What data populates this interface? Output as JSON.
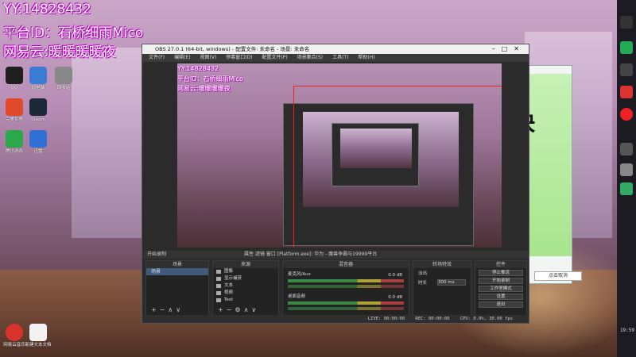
{
  "overlay": {
    "line1": "YY:14828432",
    "line2": "平台ID：石桥细雨Mico",
    "line3": "网易云:暖暖暖暖夜"
  },
  "desktop_icons": [
    {
      "label": "QQ",
      "color": "#1f1f1f"
    },
    {
      "label": "此电脑",
      "color": "#3a7bd5"
    },
    {
      "label": "回收站",
      "color": "#888888"
    },
    {
      "label": "完美世界",
      "color": "#e04a2a"
    },
    {
      "label": "Steam",
      "color": "#1b2838"
    },
    {
      "label": "腾讯游戏",
      "color": "#2aa84a"
    },
    {
      "label": "迅雷",
      "color": "#2f6fd6"
    },
    {
      "label": "网易云音乐",
      "color": "#d8322c"
    },
    {
      "label": "新建文本文档",
      "color": "#f2f2f2"
    }
  ],
  "phone": {
    "big1": "畅快",
    "big2": "(((",
    "button": "点击取消"
  },
  "obs": {
    "title": "OBS 27.0.1 (64-bit, windows) - 配置文件: 未命名 - 场景: 未命名",
    "menu": [
      "文件(F)",
      "编辑(E)",
      "视图(V)",
      "停靠窗口(D)",
      "配置文件(P)",
      "场景集合(S)",
      "工具(T)",
      "帮助(H)"
    ],
    "preview_overlay": {
      "line1": "YY:14828432",
      "line2": "平台ID：石桥细雨Mico",
      "line3": "网易云:暖暖暖暖夜"
    },
    "dock_bar_left": "开始录制",
    "dock_bar_mid": "属性  滤镜  窗口 [Platform.exe]: 华为 - 魔兽争霸与19999平台",
    "docks": {
      "scenes": {
        "title": "场景",
        "items": [
          "场景"
        ]
      },
      "sources": {
        "title": "来源",
        "items": [
          "图像",
          "显示捕获",
          "文本",
          "视频",
          "Text"
        ]
      },
      "mixer": {
        "title": "混音器",
        "tracks": [
          {
            "name": "麦克风/Aux",
            "value": "0.0 dB"
          },
          {
            "name": "桌面音频",
            "value": "0.0 dB"
          }
        ]
      },
      "transitions": {
        "title": "转场特效",
        "type": "淡出",
        "duration_label": "时长",
        "duration": "300 ms"
      },
      "controls": {
        "title": "控件",
        "buttons": [
          "停止推流",
          "开始录制",
          "工作室模式",
          "设置",
          "退出"
        ]
      }
    },
    "status": {
      "live": "LIVE: 00:00:00",
      "rec": "REC: 00:00:00",
      "cpu": "CPU: 0.0%, 30.00 fps"
    }
  },
  "taskbar": {
    "time": "19:59"
  }
}
